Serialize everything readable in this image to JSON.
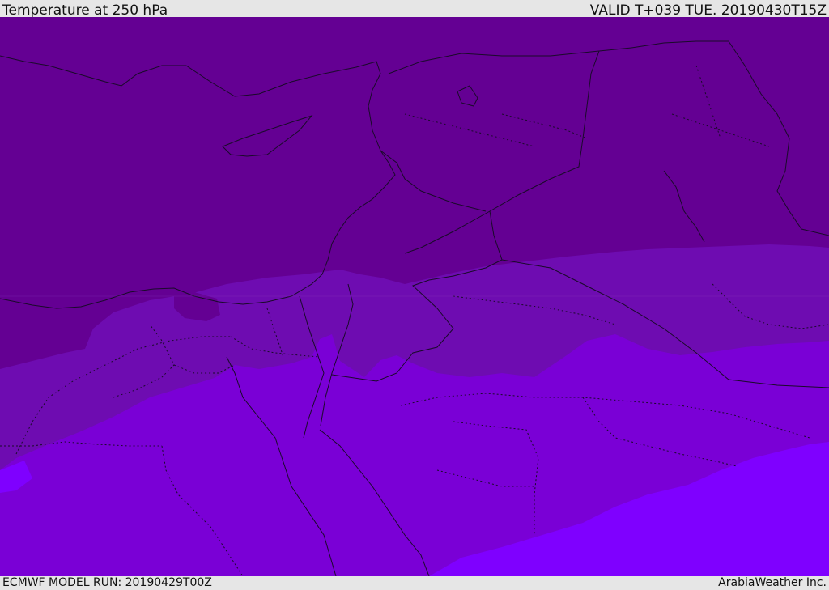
{
  "header": {
    "title": "Temperature at 250 hPa",
    "valid_time": "VALID T+039 TUE. 20190430T15Z"
  },
  "footer": {
    "model_run": "ECMWF MODEL RUN: 20190429T00Z",
    "credit": "ArabiaWeather Inc."
  },
  "colors": {
    "band_coldest": "#640093",
    "band_2": "#6e0cb1",
    "band_3": "#7a00d6",
    "band_warmest": "#7f00ff",
    "outline": "#1a0a2a"
  }
}
